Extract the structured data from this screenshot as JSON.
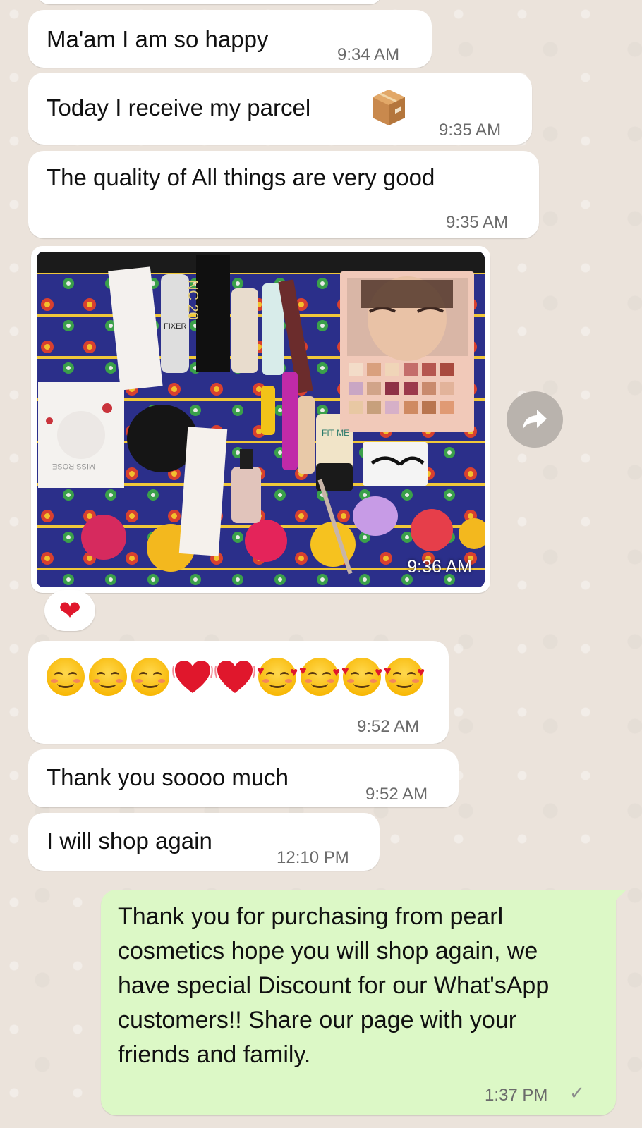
{
  "messages": [
    {
      "text": "Ma'am I am so happy",
      "time": "9:34 AM"
    },
    {
      "text": "Today I receive my parcel",
      "time": "9:35 AM"
    },
    {
      "text": "The quality of All things are very good",
      "time": "9:35 AM"
    },
    {
      "type": "image",
      "time": "9:36 AM",
      "reaction": "❤"
    },
    {
      "type": "emoji",
      "time": "9:52 AM"
    },
    {
      "text": "Thank you soooo much",
      "time": "9:52 AM"
    },
    {
      "text": "I will shop again",
      "time": "12:10 PM"
    }
  ],
  "outgoing": {
    "text": "Thank you for purchasing from pearl cosmetics hope you will shop again, we have special Discount for our What'sApp customers!! Share our page with your friends and family.",
    "time": "1:37 PM",
    "status": "✓"
  },
  "photo_labels": {
    "foundation_box": "NC 20",
    "fixer": "FIXER",
    "fit_me": "FIT ME",
    "miss_rose": "MISS ROSE"
  },
  "colors": {
    "incoming_bubble": "#ffffff",
    "outgoing_bubble": "#dcf8c6",
    "background": "#ece5dd",
    "heart": "#e0172c"
  },
  "icons": [
    "parcel-emoji",
    "forward-icon",
    "heart-reaction",
    "smiling-face-emoji",
    "beating-heart-emoji",
    "smiling-face-with-hearts-emoji",
    "single-check-icon"
  ]
}
